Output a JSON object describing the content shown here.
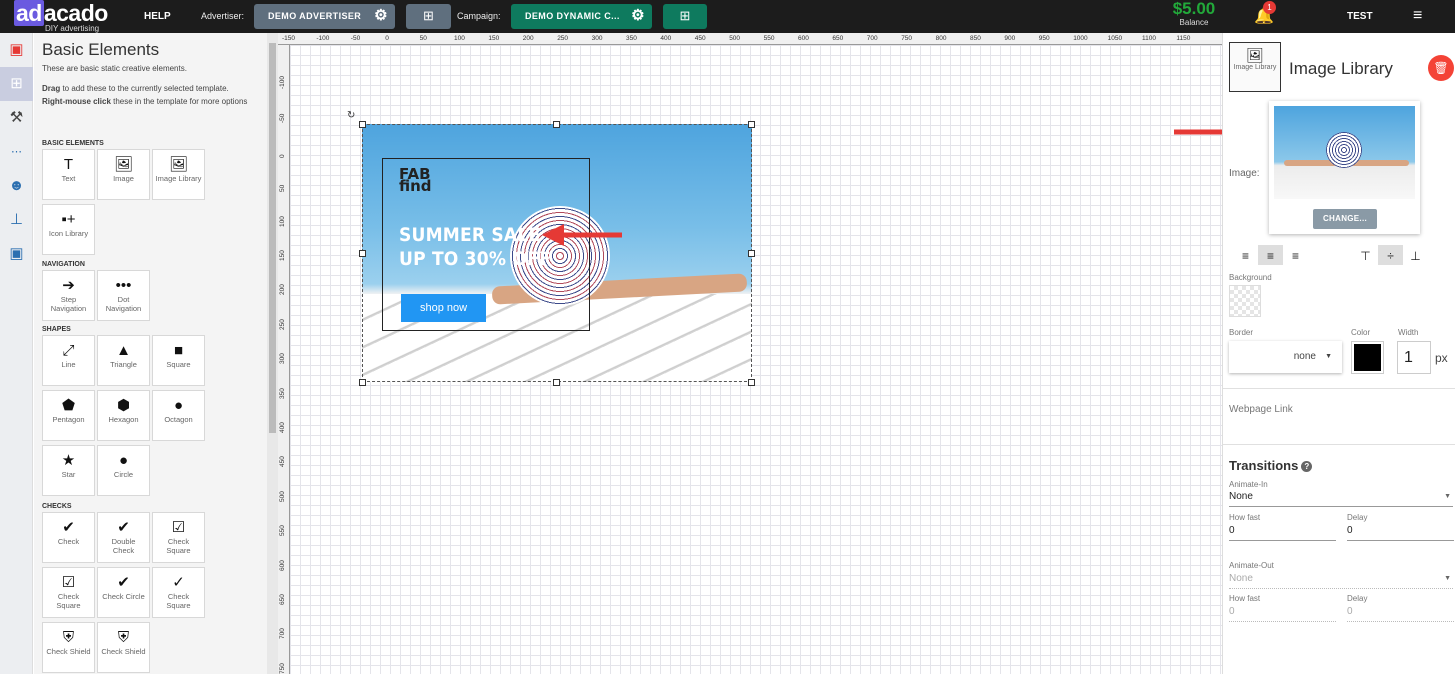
{
  "topbar": {
    "logo_text": "adacado",
    "logo_tagline": "DIY advertising",
    "help": "HELP",
    "advertiser_label": "Advertiser:",
    "advertiser_value": "DEMO ADVERTISER",
    "campaign_label": "Campaign:",
    "campaign_value": "DEMO DYNAMIC C...",
    "balance_amount": "$5.00",
    "balance_label": "Balance",
    "notification_count": "1",
    "user": "TEST",
    "colors": {
      "advertiser_btn": "#5f6f7e",
      "campaign_btn": "#0e7a5e",
      "balance": "#22a83a"
    }
  },
  "rail": {
    "icons": [
      "pdf-icon",
      "add-element-icon",
      "tools-icon",
      "layout-icon",
      "emoji-icon",
      "stamp-icon",
      "twitter-icon"
    ]
  },
  "panel": {
    "title": "Basic Elements",
    "subtitle": "These are basic static creative elements.",
    "help_drag_bold": "Drag",
    "help_drag_rest": " to add these to the currently selected template.",
    "help_right_bold": "Right-mouse click",
    "help_right_rest": " these in the template for more options",
    "sections": {
      "basic": "BASIC ELEMENTS",
      "navigation": "NAVIGATION",
      "shapes": "SHAPES",
      "checks": "CHECKS"
    },
    "tiles": {
      "text": {
        "glyph": "T",
        "label": "Text"
      },
      "image": {
        "glyph": "🖼",
        "label": "Image"
      },
      "image_library": {
        "glyph": "🖼",
        "label": "Image Library"
      },
      "icon_library": {
        "glyph": "▪+",
        "label": "Icon Library"
      },
      "step_nav": {
        "glyph": "➔",
        "label": "Step Navigation"
      },
      "dot_nav": {
        "glyph": "•••",
        "label": "Dot Navigation"
      },
      "line": {
        "glyph": "⤢",
        "label": "Line"
      },
      "triangle": {
        "glyph": "▲",
        "label": "Triangle"
      },
      "square": {
        "glyph": "■",
        "label": "Square"
      },
      "pentagon": {
        "glyph": "⬟",
        "label": "Pentagon"
      },
      "hexagon": {
        "glyph": "⬢",
        "label": "Hexagon"
      },
      "octagon": {
        "glyph": "●",
        "label": "Octagon"
      },
      "star": {
        "glyph": "★",
        "label": "Star"
      },
      "circle": {
        "glyph": "●",
        "label": "Circle"
      },
      "check": {
        "glyph": "✔",
        "label": "Check"
      },
      "double_check": {
        "glyph": "✔",
        "label": "Double Check"
      },
      "check_square": {
        "glyph": "☑",
        "label": "Check Square"
      },
      "check_square_2": {
        "glyph": "☑",
        "label": "Check Square"
      },
      "check_circle": {
        "glyph": "✔",
        "label": "Check Circle"
      },
      "check_square_3": {
        "glyph": "✓",
        "label": "Check Square"
      },
      "check_shield": {
        "glyph": "⛨",
        "label": "Check Shield"
      },
      "check_shield_2": {
        "glyph": "⛨",
        "label": "Check Shield"
      }
    }
  },
  "ruler": {
    "top_ticks": [
      "-150",
      "-100",
      "-50",
      "0",
      "50",
      "100",
      "150",
      "200",
      "250",
      "300",
      "350",
      "400",
      "450",
      "500",
      "550",
      "600",
      "650",
      "700",
      "750",
      "800",
      "850",
      "900",
      "950",
      "1000",
      "1050",
      "1100",
      "1150"
    ],
    "left_ticks": [
      "-100",
      "-50",
      "0",
      "50",
      "100",
      "150",
      "200",
      "250",
      "300",
      "350",
      "400",
      "450",
      "500",
      "550",
      "600",
      "650",
      "700",
      "750"
    ]
  },
  "creative": {
    "brand_line1": "FAB",
    "brand_line2": "find",
    "headline_line1": "SUMMER SALE",
    "headline_line2": "UP TO 30% OFF",
    "cta": "shop now",
    "cta_color": "#2196f3"
  },
  "inspector": {
    "tile_label": "Image Library",
    "title": "Image Library",
    "image_label": "Image:",
    "change_button": "CHANGE...",
    "background_label": "Background",
    "border_label": "Border",
    "color_label": "Color",
    "width_label": "Width",
    "border_value": "none",
    "width_value": "1",
    "width_unit": "px",
    "border_color": "#000000",
    "webpage_link_placeholder": "Webpage Link",
    "transitions_title": "Transitions",
    "animate_in_label": "Animate-In",
    "animate_in_value": "None",
    "how_fast_label": "How fast",
    "how_fast_value": "0",
    "delay_label": "Delay",
    "delay_value": "0",
    "animate_out_label": "Animate-Out",
    "animate_out_value": "None",
    "how_fast_out_label": "How fast",
    "how_fast_out_value": "0",
    "delay_out_label": "Delay",
    "delay_out_value": "0",
    "delete_color": "#f44336"
  },
  "annotations": {
    "arrow_color": "#e53935"
  }
}
